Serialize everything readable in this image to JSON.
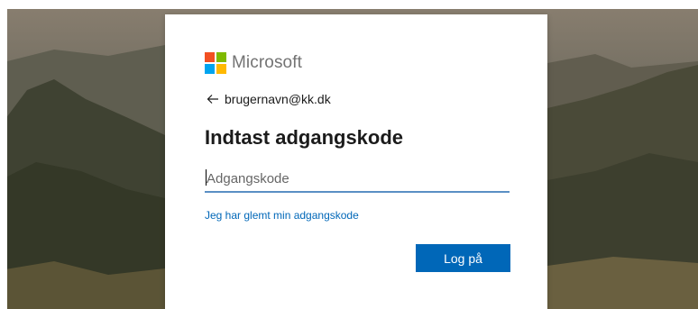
{
  "brand": {
    "name": "Microsoft",
    "colors": {
      "red": "#f25022",
      "green": "#7fba00",
      "blue": "#00a4ef",
      "yellow": "#ffb900"
    }
  },
  "identity": {
    "back_icon": "arrow-left-icon",
    "email": "brugernavn@kk.dk"
  },
  "title": "Indtast adgangskode",
  "password_field": {
    "value": "",
    "placeholder": "Adgangskode"
  },
  "forgot_link": "Jeg har glemt min adgangskode",
  "signin_button": "Log på",
  "accent_color": "#0067b8"
}
